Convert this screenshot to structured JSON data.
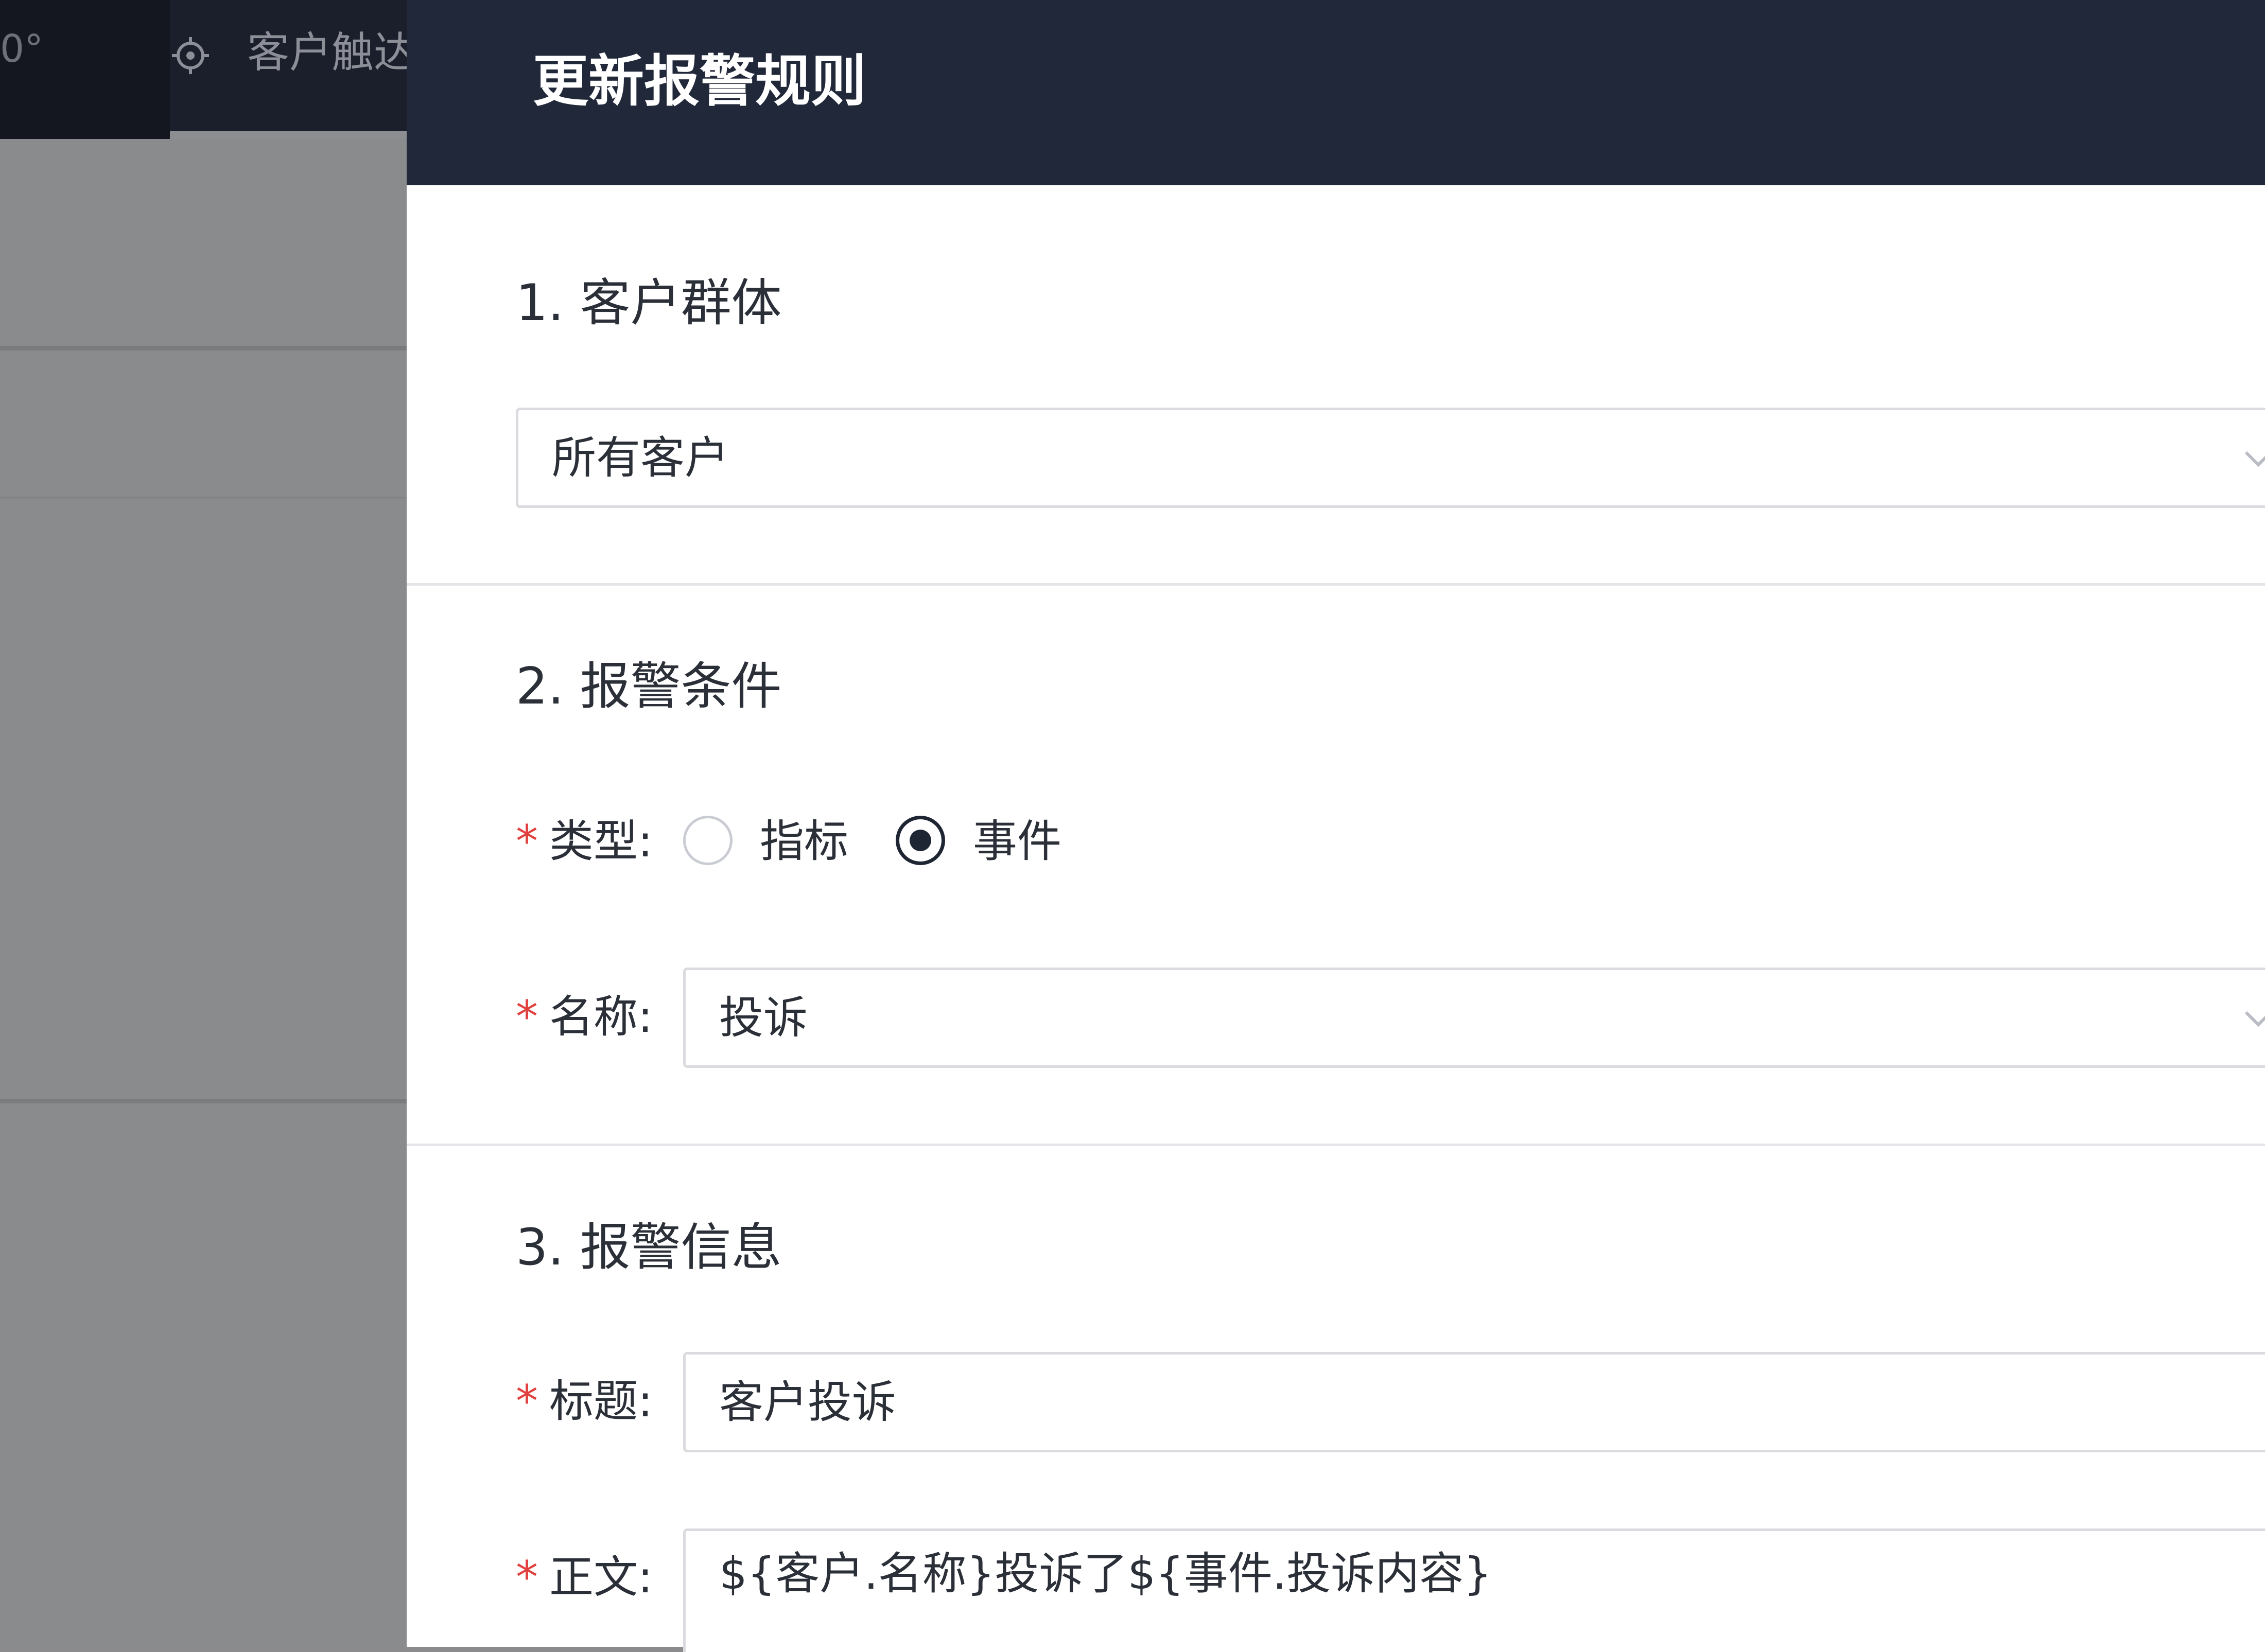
{
  "background": {
    "nav_left_text": "0°",
    "nav_item_label": "客户触达",
    "nav_item_icon": "target-icon"
  },
  "drawer": {
    "title": "更新报警规则",
    "section1": {
      "title": "1. 客户群体",
      "audience_value": "所有客户"
    },
    "section2": {
      "title": "2. 报警条件",
      "type_label": "类型:",
      "type_options": [
        "指标",
        "事件"
      ],
      "type_selected": "事件",
      "name_label": "名称:",
      "name_value": "投诉"
    },
    "section3": {
      "title": "3. 报警信息",
      "title_label": "标题:",
      "title_value": "客户投诉",
      "body_label": "正文:",
      "body_value": "${客户.名称}投诉了${事件.投诉内容}"
    },
    "required_mark": "*"
  },
  "colors": {
    "header_bg": "#212839",
    "required": "#e0403e",
    "overlay": "#8a8b8d"
  }
}
